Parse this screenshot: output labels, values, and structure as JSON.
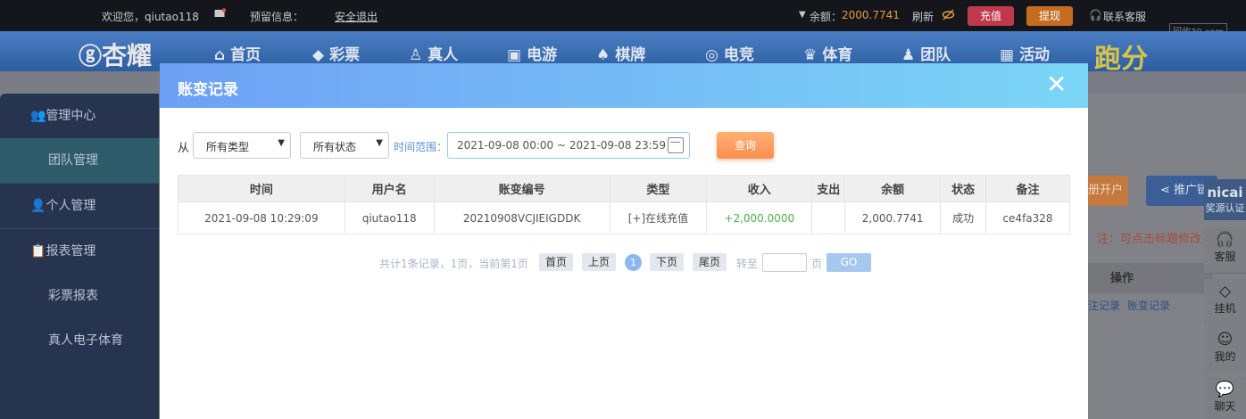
{
  "topbar": {
    "welcome": "欢迎您，qiutao118",
    "reserve": "预留信息：",
    "logout": "安全退出",
    "balance_label": "余额：",
    "balance_value": "2000.7741",
    "refresh": "刷新",
    "recharge": "充值",
    "withdraw": "提现",
    "support": "联系客服",
    "watermark": "回收30.com"
  },
  "brand": {
    "logo": "杏耀",
    "promo": "跑分"
  },
  "nav": {
    "home": "首页",
    "lottery": "彩票",
    "live": "真人",
    "slots": "电游",
    "cards": "棋牌",
    "esports": "电竞",
    "sports": "体育",
    "team": "团队",
    "events": "活动"
  },
  "sidebar": {
    "management_center": "管理中心",
    "team_management": "团队管理",
    "personal_management": "个人管理",
    "report_management": "报表管理",
    "lottery_report": "彩票报表",
    "live_report": "真人电子体育"
  },
  "background_panel": {
    "open_account": "册开户",
    "promote": "推广链",
    "note": "注：可点击标题修改",
    "actions_header": "操作",
    "link_records": "注记录",
    "link_changes": "账变记录",
    "side_nicai": "nicai",
    "side_source": "奖源认证",
    "side_service": "客服",
    "side_hang": "挂机",
    "side_mine": "我的",
    "side_chat": "聊天"
  },
  "modal": {
    "title": "账变记录",
    "close": "✕",
    "from_label": "从",
    "type_select": "所有类型",
    "status_select": "所有状态",
    "time_label": "时间范围：",
    "date_range": "2021-09-08 00:00 ~ 2021-09-08 23:59",
    "query": "查询",
    "columns": {
      "time": "时间",
      "user": "用户名",
      "serial": "账变编号",
      "type": "类型",
      "income": "收入",
      "expense": "支出",
      "balance": "余额",
      "status": "状态",
      "remark": "备注"
    },
    "row": {
      "time": "2021-09-08 10:29:09",
      "user": "qiutao118",
      "serial": "20210908VCJIEIGDDK",
      "type": "[+]在线充值",
      "income": "+2,000.0000",
      "expense": "",
      "balance": "2,000.7741",
      "status": "成功",
      "remark": "ce4fa328"
    },
    "pager": {
      "summary": "共计1条记录，1页，当前第1页",
      "first": "首页",
      "prev": "上页",
      "current": "1",
      "next": "下页",
      "last": "尾页",
      "goto": "转至",
      "page_unit": "页",
      "go": "GO"
    }
  },
  "colors": {
    "accent": "#6ea0f5",
    "income": "#4caf50",
    "query": "#fb8f52",
    "recharge": "#c0394b",
    "withdraw": "#c46d21",
    "balance": "#e89a3c"
  }
}
